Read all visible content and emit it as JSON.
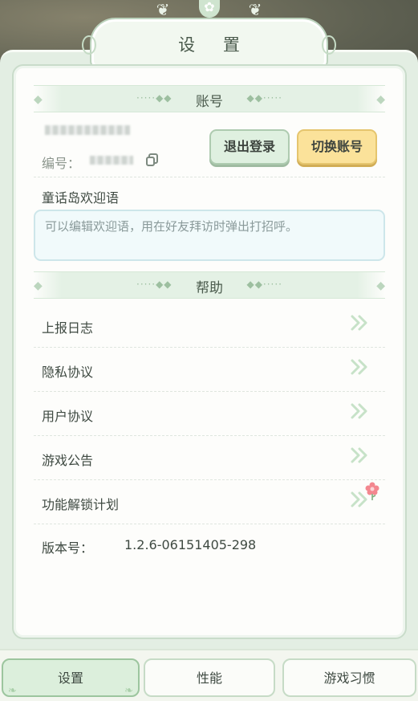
{
  "header": {
    "title": "设 置"
  },
  "account": {
    "section_title": "账号",
    "id_label": "编号：",
    "logout_label": "退出登录",
    "switch_label": "切换账号"
  },
  "welcome": {
    "label": "童话岛欢迎语",
    "placeholder": "可以编辑欢迎语，用在好友拜访时弹出打招呼。"
  },
  "help": {
    "section_title": "帮助",
    "items": [
      {
        "label": "上报日志"
      },
      {
        "label": "隐私协议"
      },
      {
        "label": "用户协议"
      },
      {
        "label": "游戏公告"
      },
      {
        "label": "功能解锁计划"
      }
    ]
  },
  "version": {
    "label": "版本号：",
    "value": "1.2.6-06151405-298"
  },
  "tabs": [
    {
      "label": "设置"
    },
    {
      "label": "性能"
    },
    {
      "label": "游戏习惯"
    }
  ],
  "colors": {
    "accent_green": "#dcefdc",
    "accent_yellow": "#fbe29a",
    "text": "#3f4a42"
  }
}
